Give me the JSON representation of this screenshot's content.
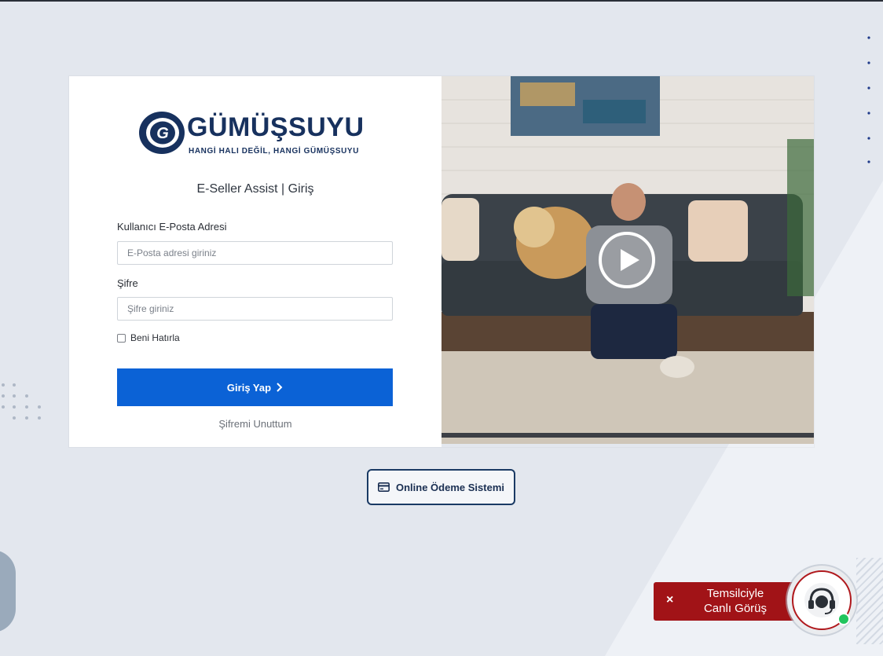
{
  "brand": {
    "logo_letter": "G",
    "name": "GÜMÜŞSUYU",
    "tagline": "HANGİ HALI DEĞİL, HANGİ GÜMÜŞSUYU",
    "color": "#17315e"
  },
  "login": {
    "title": "E-Seller Assist | Giriş",
    "email_label": "Kullanıcı E-Posta Adresi",
    "email_placeholder": "E-Posta adresi giriniz",
    "password_label": "Şifre",
    "password_placeholder": "Şifre giriniz",
    "remember_label": "Beni Hatırla",
    "submit_label": "Giriş Yap",
    "forgot_label": "Şifremi Unuttum",
    "accent": "#0b62d6"
  },
  "video": {
    "play_icon": "play-circle-icon"
  },
  "payment": {
    "label": "Online Ödeme Sistemi",
    "icon": "credit-card-icon"
  },
  "chat": {
    "close_label": "×",
    "line1": "Temsilciyle",
    "line2": "Canlı Görüş",
    "icon": "headset-icon",
    "color": "#a11317",
    "status_color": "#22c55e"
  }
}
